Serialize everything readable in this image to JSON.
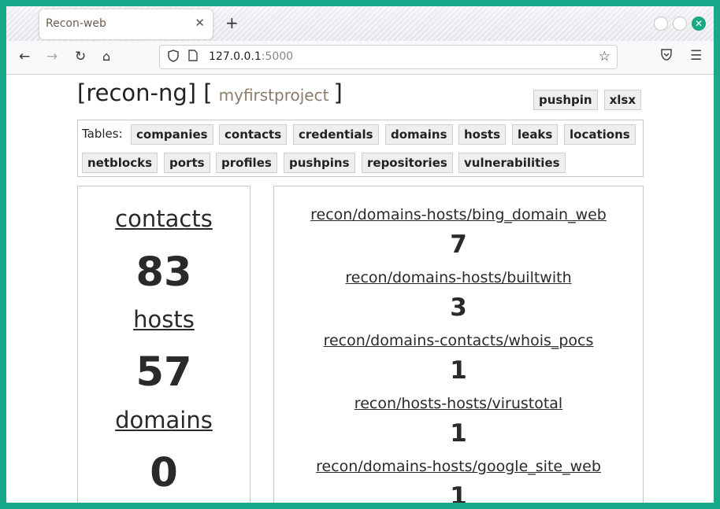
{
  "browser": {
    "tab_title": "Recon-web",
    "tab_close": "✕",
    "new_tab": "+",
    "url_host": "127.0.0.1",
    "url_port": ":5000"
  },
  "header": {
    "app": "[recon-ng]",
    "open_bracket": "[",
    "project": "myfirstproject",
    "close_bracket": "]",
    "links": [
      "pushpin",
      "xlsx"
    ]
  },
  "tables": {
    "label": "Tables:",
    "items": [
      "companies",
      "contacts",
      "credentials",
      "domains",
      "hosts",
      "leaks",
      "locations",
      "netblocks",
      "ports",
      "profiles",
      "pushpins",
      "repositories",
      "vulnerabilities"
    ]
  },
  "summary": [
    {
      "name": "contacts",
      "count": "83"
    },
    {
      "name": "hosts",
      "count": "57"
    },
    {
      "name": "domains",
      "count": "0"
    }
  ],
  "modules": [
    {
      "name": "recon/domains-hosts/bing_domain_web",
      "count": "7"
    },
    {
      "name": "recon/domains-hosts/builtwith",
      "count": "3"
    },
    {
      "name": "recon/domains-contacts/whois_pocs",
      "count": "1"
    },
    {
      "name": "recon/hosts-hosts/virustotal",
      "count": "1"
    },
    {
      "name": "recon/domains-hosts/google_site_web",
      "count": "1"
    }
  ]
}
